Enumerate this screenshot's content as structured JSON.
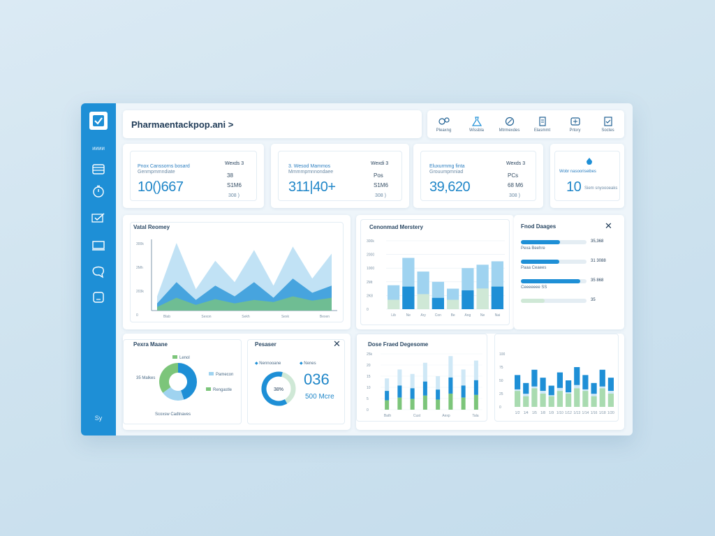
{
  "app": {
    "title": "Pharmaentackpop.ani >",
    "sidebar": {
      "top_label": "ᴎᴎᴎᴎ",
      "bottom_label": "Sy",
      "icons": [
        "calendar-icon",
        "clock-icon",
        "check-list-icon",
        "monitor-icon",
        "chat-icon",
        "sticky-note-icon"
      ]
    },
    "toolbar": [
      {
        "icon": "pill-chart-icon",
        "label": "Pleaxng"
      },
      {
        "icon": "flask-icon",
        "label": "Wissbla"
      },
      {
        "icon": "pill-icon",
        "label": "Mtrmexdes"
      },
      {
        "icon": "clipboard-icon",
        "label": "Elasmmt"
      },
      {
        "icon": "medical-box-icon",
        "label": "Prtory"
      },
      {
        "icon": "clipboard-check-icon",
        "label": "Soctes"
      }
    ]
  },
  "kpis": [
    {
      "label": "Pnox Canssorns bosard",
      "sublabel": "Genmpmmndiate",
      "value": "10()667",
      "tag": "Wexds 3",
      "right1": "38",
      "right2": "S1M6",
      "note": "308 )"
    },
    {
      "label": "3. Wesod Mammos",
      "sublabel": "Mmmmpmnnondaee",
      "value": "311|40+",
      "tag": "Wexdi 3",
      "right1": "Pos",
      "right2": "S1M6",
      "note": "308 )"
    },
    {
      "label": "Eluxurmmg finta",
      "sublabel": "Grouumpmniad",
      "value": "39,620",
      "tag": "Wexds 3",
      "right1": "PCs",
      "right2": "68 M6",
      "note": "308 )"
    },
    {
      "label": "Wobr nasooriseibes",
      "sublabel": "Siem snyoooeaks",
      "value": "10",
      "tag": "",
      "right1": "",
      "right2": "",
      "note": ""
    }
  ],
  "cards": {
    "volume": {
      "title": "Vatal Reomey",
      "y_ticks": [
        "300k",
        "2Mh",
        "203k",
        "0"
      ],
      "x_ticks": [
        "Blab",
        "Sexon",
        "Sekh",
        "Sexk",
        "Bexen"
      ]
    },
    "hist": {
      "title": "Cenonmad Merstery",
      "y_ticks": [
        "300k",
        "2000",
        "1000",
        "2Mt",
        "2K8",
        "0"
      ],
      "x_ticks": [
        "Lib",
        "Ne",
        "Ary",
        "Con",
        "Be",
        "Ang",
        "Ne",
        "Nai"
      ]
    },
    "fixed": {
      "title": "Fnod Daages",
      "rows": [
        {
          "label": "Pexa Beehre",
          "value": "35,368"
        },
        {
          "label": "Paaa Ceaees",
          "value": "31 3088"
        },
        {
          "label": "Ceeeeeee SS",
          "value": "35 868"
        },
        {
          "label": "",
          "value": "35"
        }
      ]
    },
    "donut1": {
      "title": "Pexra Maane",
      "left_label": "35 Malkes",
      "bottom_label": "Scoxsw Cadtnaves",
      "legend": [
        "Lenol",
        "Pamecon",
        "Rengastle"
      ]
    },
    "donut2": {
      "title": "Pesaser",
      "legend": [
        "Nennooane",
        "Nenes"
      ],
      "center": "38%",
      "big": "036",
      "sub": "500 Mcre"
    },
    "stacked": {
      "title": "Dose Fraed Degesome",
      "y_ticks": [
        "25k",
        "20",
        "15",
        "10",
        "5",
        "0"
      ],
      "x_ticks": [
        "Bath",
        "Cust",
        "Aexp",
        "Tala"
      ]
    },
    "mini": {
      "title": "",
      "y_ticks": [
        "100",
        "75",
        "50",
        "25",
        "0"
      ],
      "x_ticks": [
        "1/2",
        "1/4",
        "1/5",
        "1/8",
        "1/9",
        "1/10",
        "1/12",
        "1/13",
        "1/14",
        "1/16",
        "1/18",
        "1/20"
      ]
    }
  },
  "chart_data": [
    {
      "type": "area",
      "title": "Vatal Reomey",
      "series": [
        {
          "values": [
            20,
            95,
            30,
            70,
            40,
            85,
            35,
            90,
            45,
            80
          ]
        },
        {
          "values": [
            10,
            40,
            15,
            35,
            20,
            40,
            18,
            45,
            25,
            35
          ]
        },
        {
          "values": [
            5,
            18,
            8,
            16,
            10,
            15,
            12,
            20,
            14,
            18
          ]
        }
      ]
    },
    {
      "type": "bar",
      "title": "Cenonmad Merstery",
      "categories": [
        "Lib",
        "Ne",
        "Ary",
        "Con",
        "Be",
        "Ang",
        "Ne",
        "Nai"
      ],
      "series": [
        {
          "values": [
            35,
            75,
            55,
            40,
            30,
            60,
            65,
            70
          ]
        },
        {
          "values": [
            25,
            60,
            40,
            30,
            25,
            50,
            55,
            60
          ]
        }
      ]
    },
    {
      "type": "bar",
      "title": "Dose Fraed Degesome",
      "categories": [
        "Bath",
        "Cust",
        "Aexp",
        "Tala"
      ],
      "series": [
        {
          "values": [
            8,
            10,
            9,
            12,
            8,
            14,
            10,
            13
          ]
        },
        {
          "values": [
            6,
            8,
            7,
            9,
            7,
            10,
            8,
            9
          ]
        }
      ]
    },
    {
      "type": "bar",
      "title": "",
      "series": [
        {
          "values": [
            60,
            45,
            70,
            55,
            40,
            65,
            50,
            75,
            60,
            45,
            70,
            55
          ]
        },
        {
          "values": [
            30,
            20,
            35,
            25,
            20,
            30,
            25,
            35,
            30,
            20,
            35,
            25
          ]
        }
      ]
    }
  ],
  "colors": {
    "primary": "#1e8fd6",
    "light": "#9fd3f0",
    "green": "#7cc57a",
    "pale": "#cfe8f6"
  }
}
